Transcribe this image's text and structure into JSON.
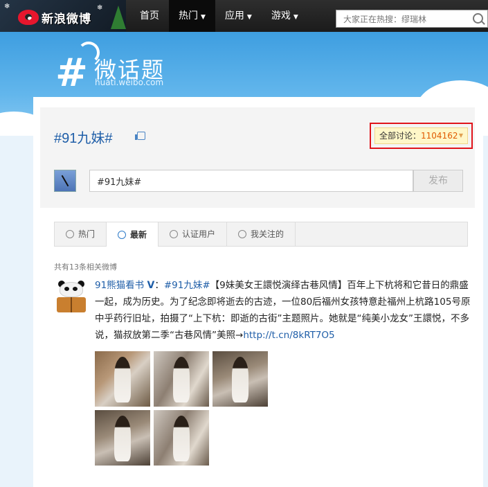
{
  "nav": {
    "logo_text": "新浪微博",
    "items": [
      {
        "label": "首页",
        "has_menu": false
      },
      {
        "label": "热门",
        "has_menu": true,
        "active": true
      },
      {
        "label": "应用",
        "has_menu": true
      },
      {
        "label": "游戏",
        "has_menu": true
      }
    ],
    "search_placeholder": "大家正在热搜：缪瑞林"
  },
  "banner": {
    "symbol": "#",
    "title": "微话题",
    "url": "huati.weibo.com"
  },
  "topic": {
    "title": "#91九妹#",
    "count_label": "全部讨论：",
    "count_value": "1104162",
    "input_value": "#91九妹#",
    "publish_label": "发布"
  },
  "tabs": [
    {
      "label": "热门",
      "icon": "flame-icon"
    },
    {
      "label": "最新",
      "icon": "clock-icon",
      "active": true
    },
    {
      "label": "认证用户",
      "icon": "verified-icon"
    },
    {
      "label": "我关注的",
      "icon": "person-icon"
    }
  ],
  "feed": {
    "result_count": "共有13条相关微博",
    "post": {
      "author": "91熊猫看书",
      "verified_mark": "V",
      "colon": "：",
      "topic_link": "#91九妹#",
      "body": "【9妹美女王譞悦演绎古巷风情】百年上下杭将和它昔日的鼎盛一起，成为历史。为了纪念即将逝去的古迹，一位80后福州女孩特意赴福州上杭路105号原中乎药行旧址，拍摄了“上下杭：即逝的古街”主题照片。她就是“纯美小龙女”王譞悦，不多说，猫叔放第二季“古巷风情”美照→",
      "link": "http://t.cn/8kRT7O5",
      "photo_count": 5
    }
  },
  "colors": {
    "accent_blue": "#1f5ea8",
    "highlight_red": "#e0141b",
    "count_orange": "#e05a00"
  }
}
